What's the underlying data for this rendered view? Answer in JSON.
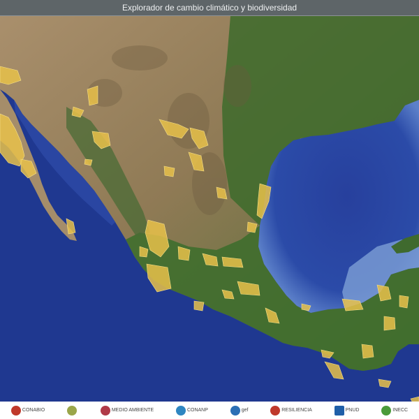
{
  "app": {
    "title": "Explorador de cambio climático y biodiversidad"
  },
  "logos": [
    {
      "name": "CONABIO",
      "text": "CONABIO",
      "color": "#c0392b"
    },
    {
      "name": "Semarnat",
      "text": "",
      "color": "#9aa64a"
    },
    {
      "name": "Medio Ambiente",
      "text": "MEDIO AMBIENTE",
      "color": "#b03a48"
    },
    {
      "name": "CONANP",
      "text": "CONANP",
      "color": "#2e86c1"
    },
    {
      "name": "GEF",
      "text": "gef",
      "color": "#2c6fb5"
    },
    {
      "name": "Resiliencia",
      "text": "RESILIENCIA",
      "color": "#c0392b"
    },
    {
      "name": "PNUD",
      "text": "PNUD",
      "color": "#1f5fa8"
    },
    {
      "name": "INECC",
      "text": "INECC",
      "color": "#4a9b3a"
    }
  ],
  "colors": {
    "ocean_deep": "#1b2f86",
    "ocean": "#2a47a5",
    "shelf": "#6a8fcf",
    "land_desert": "#b79c78",
    "land_green": "#3b6a2c",
    "protected_area": "#e7c04a"
  }
}
